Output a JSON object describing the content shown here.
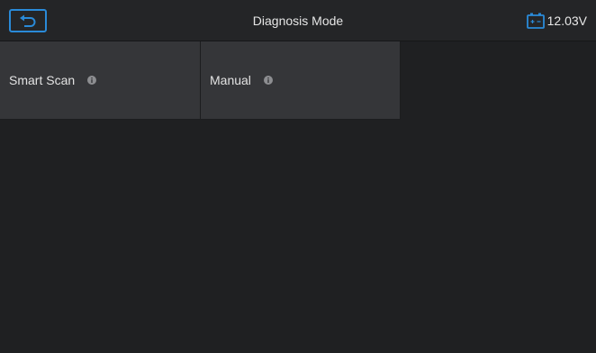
{
  "header": {
    "title": "Diagnosis Mode",
    "battery_voltage": "12.03V"
  },
  "modes": [
    {
      "label": "Smart Scan",
      "icon": "info-icon"
    },
    {
      "label": "Manual",
      "icon": "info-icon"
    }
  ],
  "colors": {
    "accent": "#2a8ad8",
    "background": "#1f2022",
    "tile": "#353639"
  }
}
